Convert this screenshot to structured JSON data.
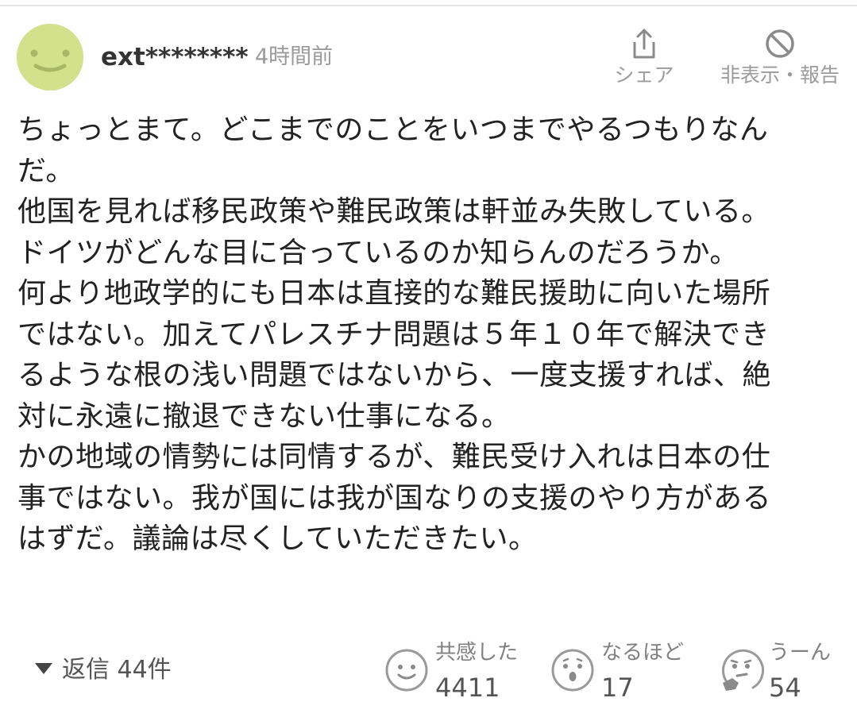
{
  "comment": {
    "username": "ext********",
    "timestamp": "4時間前",
    "avatar_color": "#d3e08c",
    "actions": {
      "share_label": "シェア",
      "share_icon": "share-icon",
      "hide_report_label": "非表示・報告",
      "hide_report_icon": "block-icon"
    },
    "body_lines": [
      "ちょっとまて。どこまでのことをいつまでやるつもりなん",
      "だ。",
      "他国を見れば移民政策や難民政策は軒並み失敗している。",
      "ドイツがどんな目に合っているのか知らんのだろうか。",
      "何より地政学的にも日本は直接的な難民援助に向いた場所",
      "ではない。加えてパレスチナ問題は５年１０年で解決でき",
      "るような根の浅い問題ではないから、一度支援すれば、絶",
      "対に永遠に撤退できない仕事になる。",
      "かの地域の情勢には同情するが、難民受け入れは日本の仕",
      "事ではない。我が国には我が国なりの支援のやり方がある",
      "はずだ。議論は尽くしていただきたい。"
    ],
    "replies": {
      "label": "返信",
      "count": "44件"
    },
    "reactions": [
      {
        "label": "共感した",
        "count": "4411",
        "icon": "smile-face-icon"
      },
      {
        "label": "なるほど",
        "count": "17",
        "icon": "surprised-face-icon"
      },
      {
        "label": "うーん",
        "count": "54",
        "icon": "thinking-face-icon"
      }
    ]
  }
}
